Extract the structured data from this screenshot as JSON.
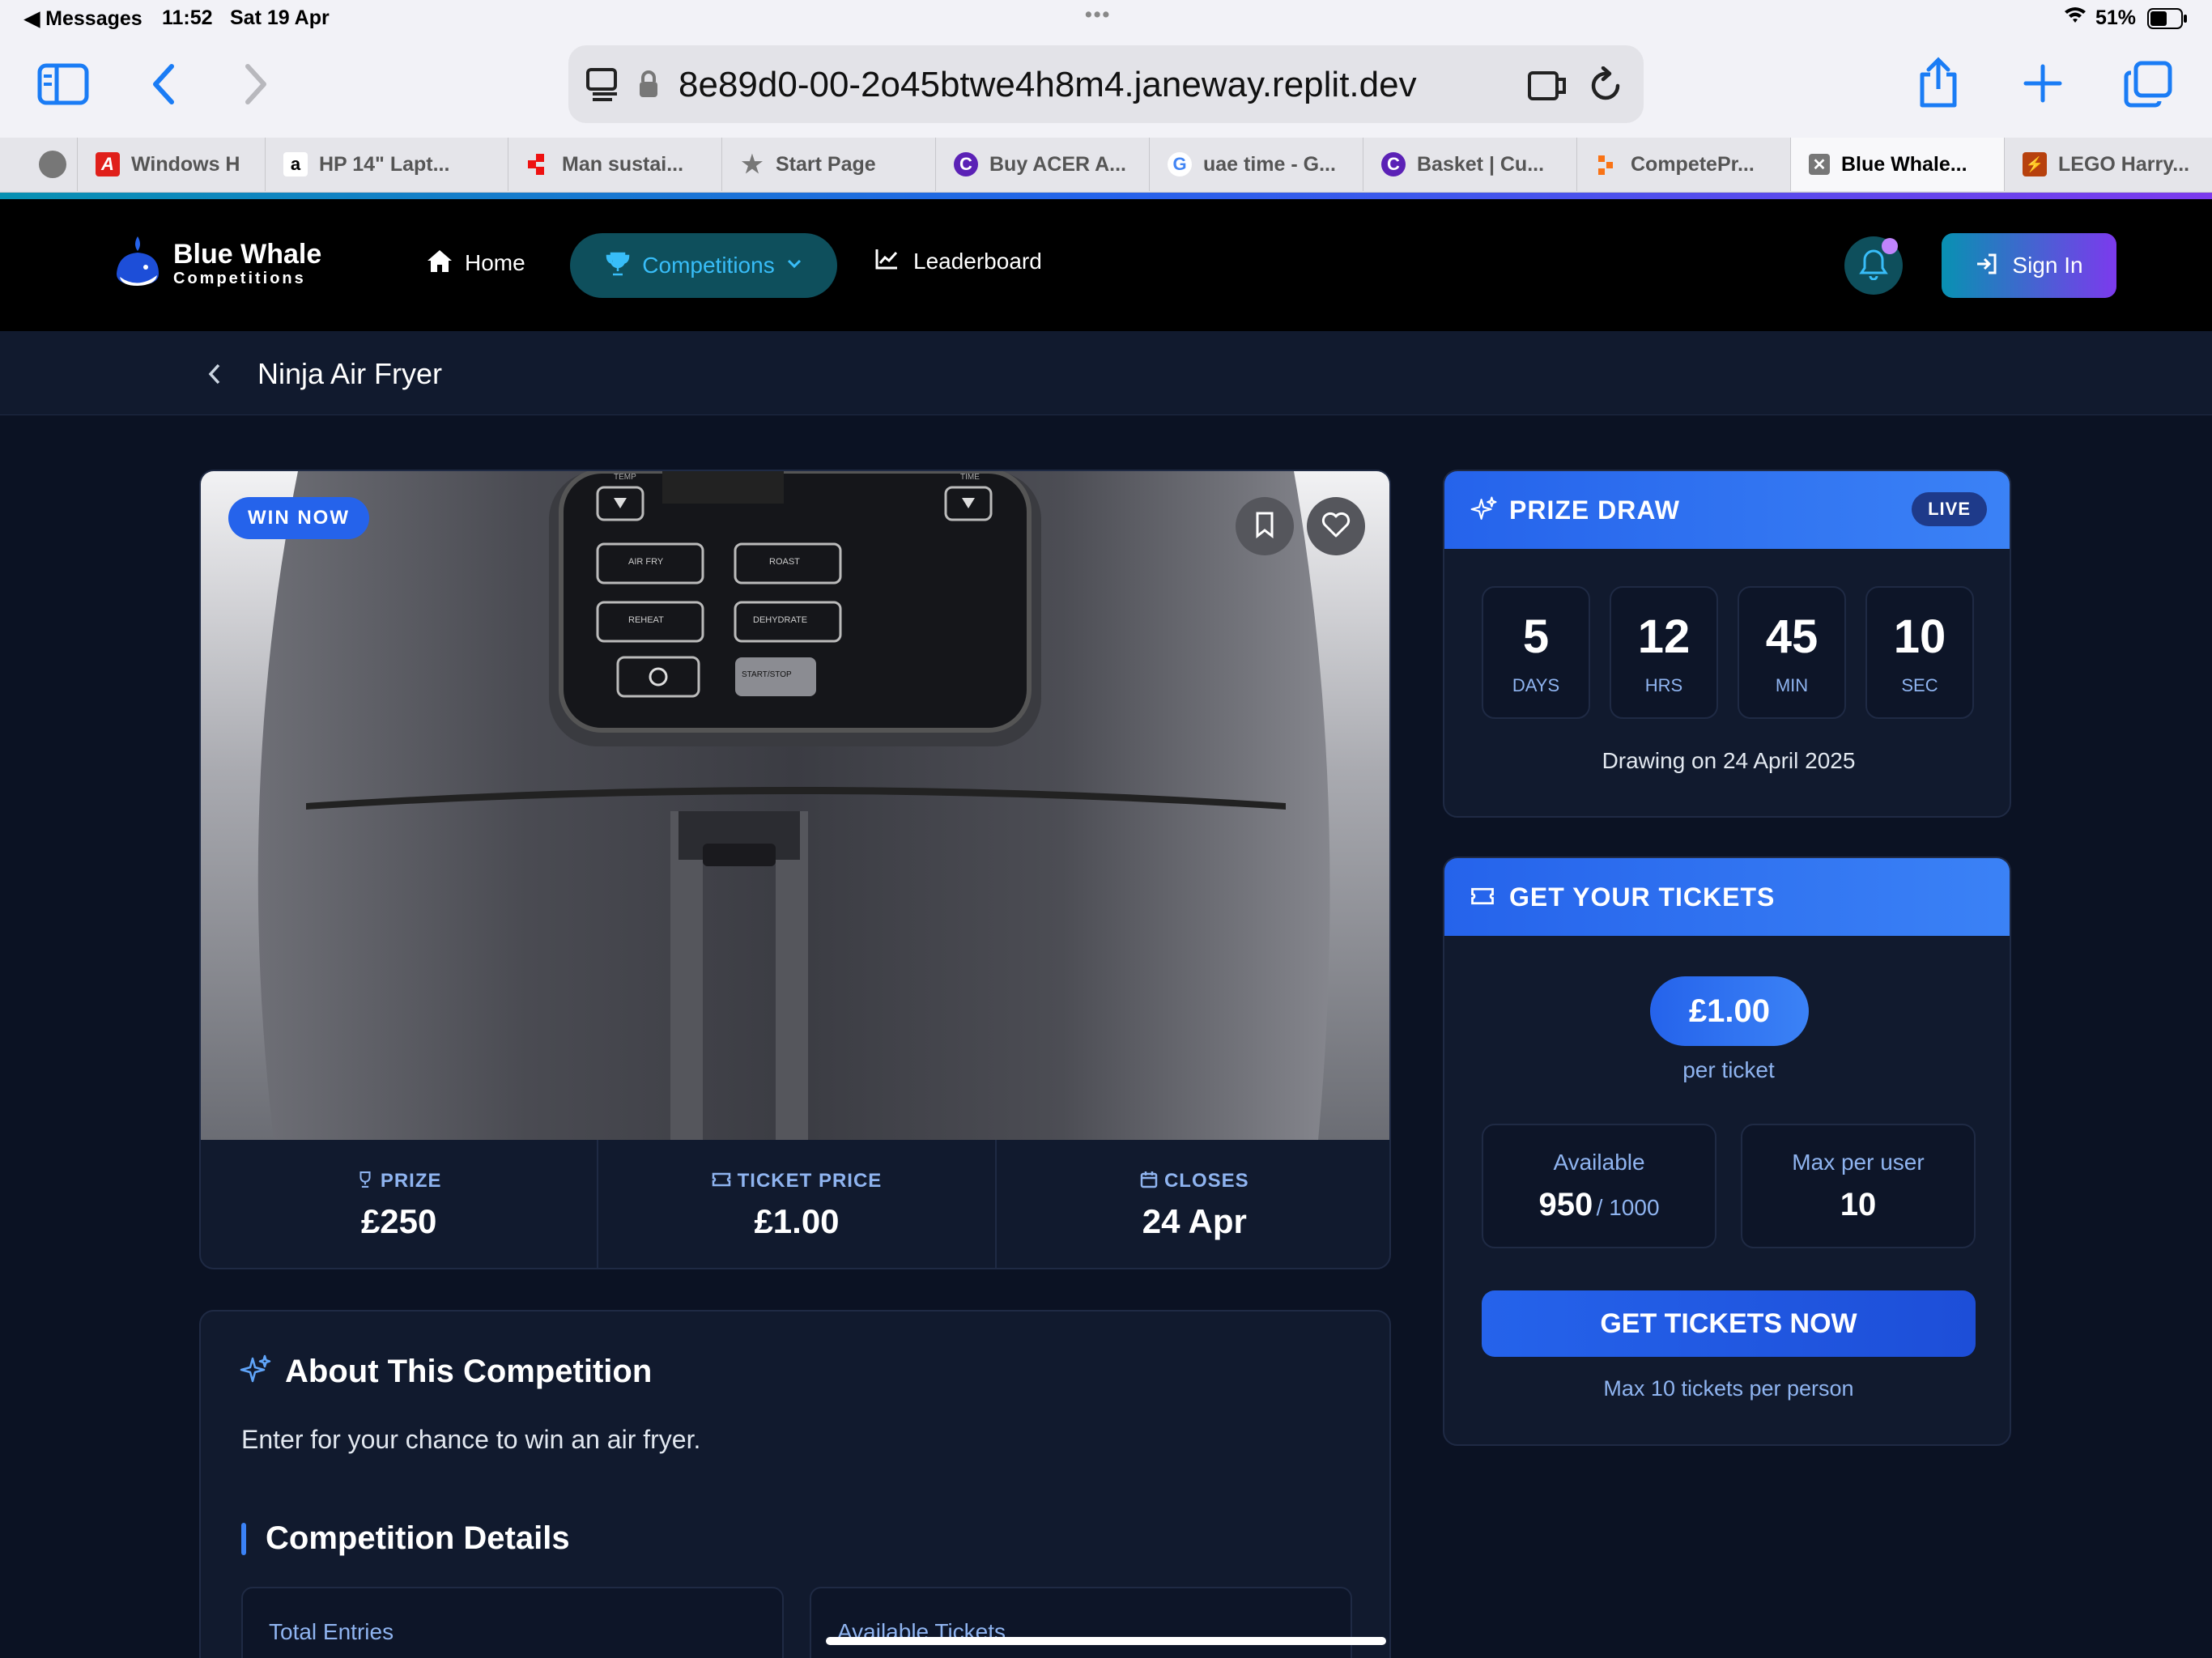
{
  "status": {
    "back": "◀ Messages",
    "time": "11:52",
    "date": "Sat 19 Apr",
    "battery": "51%"
  },
  "browser": {
    "url": "8e89d0-00-2o45btwe4h8m4.janeway.replit.dev"
  },
  "tabs": [
    {
      "label": "",
      "icon": "tab-icon"
    },
    {
      "label": "Windows H",
      "icon": "acrobat-icon"
    },
    {
      "label": "HP 14\" Lapt...",
      "icon": "amazon-icon"
    },
    {
      "label": "Man sustai...",
      "icon": "tab-icon"
    },
    {
      "label": "Start Page",
      "icon": "star-icon"
    },
    {
      "label": "Buy ACER A...",
      "icon": "c-icon"
    },
    {
      "label": "uae time - G...",
      "icon": "google-icon"
    },
    {
      "label": "Basket | Cu...",
      "icon": "c-icon"
    },
    {
      "label": "CompetePr...",
      "icon": "tab-icon"
    },
    {
      "label": "Blue Whale...",
      "icon": "close-icon"
    },
    {
      "label": "LEGO Harry...",
      "icon": "lego-icon"
    }
  ],
  "nav": {
    "brand": "Blue Whale",
    "brand_sub": "Competitions",
    "home": "Home",
    "competitions": "Competitions",
    "leaderboard": "Leaderboard",
    "sign_in": "Sign In"
  },
  "page": {
    "title": "Ninja Air Fryer"
  },
  "product": {
    "badge": "WIN NOW",
    "panel_labels": [
      "TEMP",
      "TIME",
      "AIR FRY",
      "ROAST",
      "REHEAT",
      "DEHYDRATE",
      "START/STOP"
    ],
    "stats": [
      {
        "label": "PRIZE",
        "value": "£250",
        "icon": "trophy-icon"
      },
      {
        "label": "TICKET PRICE",
        "value": "£1.00",
        "icon": "ticket-icon"
      },
      {
        "label": "CLOSES",
        "value": "24 Apr",
        "icon": "calendar-icon"
      }
    ]
  },
  "about": {
    "title": "About This Competition",
    "description": "Enter for your chance to win an air fryer.",
    "details_title": "Competition Details",
    "boxes": [
      "Total Entries",
      "Available Tickets"
    ]
  },
  "prize_draw": {
    "title": "PRIZE DRAW",
    "live": "LIVE",
    "countdown": [
      {
        "value": "5",
        "unit": "DAYS"
      },
      {
        "value": "12",
        "unit": "HRS"
      },
      {
        "value": "45",
        "unit": "MIN"
      },
      {
        "value": "10",
        "unit": "SEC"
      }
    ],
    "drawing": "Drawing on 24 April 2025"
  },
  "tickets": {
    "title": "GET YOUR TICKETS",
    "price": "£1.00",
    "per": "per ticket",
    "available_label": "Available",
    "available": "950",
    "total": "/ 1000",
    "max_label": "Max per user",
    "max": "10",
    "cta": "GET TICKETS NOW",
    "note": "Max 10 tickets per person"
  },
  "colors": {
    "bg": "#0b1223",
    "card": "#111a2e",
    "accent": "#2563eb",
    "teal": "#0e4f5c"
  }
}
